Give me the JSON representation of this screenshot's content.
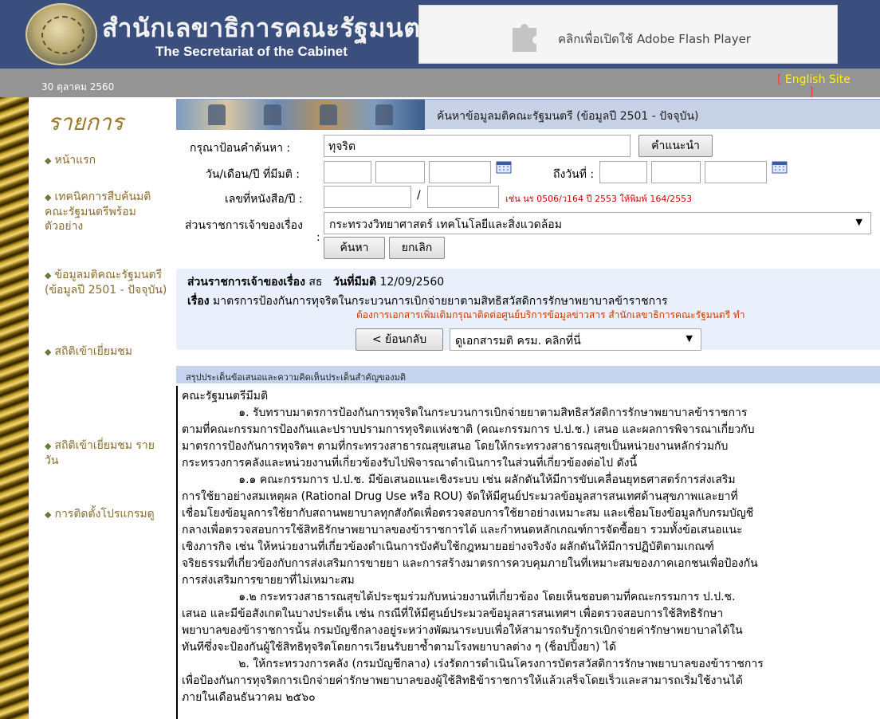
{
  "header": {
    "title_th": "สำนักเลขาธิการคณะรัฐมนตรี",
    "title_en": "The Secretariat of the Cabinet",
    "flash_prompt": "คลิกเพื่อเปิดใช้ Adobe Flash Player"
  },
  "datebar": {
    "date": "30 ตุลาคม 2560",
    "english_site": "English Site",
    "bracket_open": "[",
    "bracket_close": "]"
  },
  "sidebar": {
    "title": "รายการ",
    "items": [
      {
        "label": "หน้าแรก"
      },
      {
        "label": "เทคนิคการสืบค้นมติคณะรัฐมนตรีพร้อมตัวอย่าง"
      },
      {
        "label": "ข้อมูลมติคณะรัฐมนตรี (ข้อมูลปี 2501 - ปัจจุบัน)"
      },
      {
        "label": "สถิติเข้าเยี่ยมชม"
      },
      {
        "label": "สถิติเข้าเยี่ยมชม รายวัน"
      },
      {
        "label": "การติดตั้งโปรแกรมดู"
      }
    ]
  },
  "search": {
    "banner_title": "ค้นหาข้อมูลมติคณะรัฐมนตรี (ข้อมูลปี 2501 - ปัจจุบัน)",
    "keyword_label": "กรุณาป้อนคำค้นหา :",
    "keyword_value": "ทุจริต",
    "suggest_button": "คำแนะนำ",
    "date_label": "วัน/เดือน/ปี ที่มีมติ :",
    "to_date_label": "ถึงวันที่ :",
    "doc_no_label": "เลขที่หนังสือ/ปี :",
    "doc_slash": "/",
    "doc_hint": "เช่น นร 0506/ว164 ปี 2553 ให้พิมพ์ 164/2553",
    "agency_label": "ส่วนราชการเจ้าของเรื่อง",
    "agency_colon": ":",
    "agency_value": "กระทรวงวิทยาศาสตร์ เทคโนโลยีและสิ่งแวดล้อม",
    "search_button": "ค้นหา",
    "cancel_button": "ยกเลิก"
  },
  "result": {
    "agency_caption": "ส่วนราชการเจ้าของเรื่อง",
    "agency_value": "สธ",
    "date_caption": "วันที่มีมติ",
    "date_value": "12/09/2560",
    "subject_caption": "เรื่อง",
    "subject_value": "มาตรการป้องกันการทุจริตในกระบวนการเบิกจ่ายยาตามสิทธิสวัสดิการรักษาพยาบาลข้าราชการ",
    "note": "ต้องการเอกสารเพิ่มเติมกรุณาติดต่อศูนย์บริการข้อมูลข่าวสาร สำนักเลขาธิการคณะรัฐมนตรี ทำ",
    "back_button": "< ย้อนกลับ",
    "docs_select": "ดูเอกสารมติ ครม. คลิกที่นี่"
  },
  "summary": {
    "label": "สรุปประเด็นข้อเสนอและความคิดเห็นประเด็นสำคัญของมติ",
    "lines": [
      "คณะรัฐมนตรีมีมติ",
      "                ๑. รับทราบมาตรการป้องกันการทุจริตในกระบวนการเบิกจ่ายยาตามสิทธิสวัสดิการรักษาพยาบาลข้าราชการ",
      "ตามที่คณะกรรมการป้องกันและปราบปรามการทุจริตแห่งชาติ (คณะกรรมการ ป.ป.ช.) เสนอ และผลการพิจารณาเกี่ยวกับ",
      "มาตรการป้องกันการทุจริตฯ ตามที่กระทรวงสาธารณสุขเสนอ โดยให้กระทรวงสาธารณสุขเป็นหน่วยงานหลักร่วมกับ",
      "กระทรวงการคลังและหน่วยงานที่เกี่ยวข้องรับไปพิจารณาดำเนินการในส่วนที่เกี่ยวข้องต่อไป ดังนี้",
      "                ๑.๑ คณะกรรมการ ป.ป.ช. มีข้อเสนอแนะเชิงระบบ เช่น ผลักดันให้มีการขับเคลื่อนยุทธศาสตร์การส่งเสริม",
      "การใช้ยาอย่างสมเหตุผล (Rational Drug Use หรือ ROU) จัดให้มีศูนย์ประมวลข้อมูลสารสนเทศด้านสุขภาพและยาที่",
      "เชื่อมโยงข้อมูลการใช้ยากับสถานพยาบาลทุกสังกัดเพื่อตรวจสอบการใช้ยาอย่างเหมาะสม และเชื่อมโยงข้อมูลกับกรมบัญชี",
      "กลางเพื่อตรวจสอบการใช้สิทธิรักษาพยาบาลของข้าราชการได้ และกำหนดหลักเกณฑ์การจัดซื้อยา รวมทั้งข้อเสนอแนะ",
      "เชิงภารกิจ เช่น ให้หน่วยงานที่เกี่ยวข้องดำเนินการบังคับใช้กฎหมายอย่างจริงจัง ผลักดันให้มีการปฏิบัติตามเกณฑ์",
      "จริยธรรมที่เกี่ยวข้องกับการส่งเสริมการขายยา และการสร้างมาตรการควบคุมภายในที่เหมาะสมของภาคเอกชนเพื่อป้องกัน",
      "การส่งเสริมการขายยาที่ไม่เหมาะสม",
      "                ๑.๒ กระทรวงสาธารณสุขได้ประชุมร่วมกับหน่วยงานที่เกี่ยวข้อง โดยเห็นชอบตามที่คณะกรรมการ ป.ป.ช.",
      "เสนอ และมีข้อสังเกตในบางประเด็น เช่น กรณีที่ให้มีศูนย์ประมวลข้อมูลสารสนเทศฯ เพื่อตรวจสอบการใช้สิทธิรักษา",
      "พยาบาลของข้าราชการนั้น กรมบัญชีกลางอยู่ระหว่างพัฒนาระบบเพื่อให้สามารถรับรู้การเบิกจ่ายค่ารักษาพยาบาลได้ใน",
      "ทันทีซึ่งจะป้องกันผู้ใช้สิทธิทุจริตโดยการเวียนรับยาซ้ำตามโรงพยาบาลต่าง ๆ (ช็อปปิ้งยา) ได้",
      "                ๒. ให้กระทรวงการคลัง (กรมบัญชีกลาง) เร่งรัดการดำเนินโครงการบัตรสวัสดิการรักษาพยาบาลของข้าราชการ",
      "เพื่อป้องกันการทุจริตการเบิกจ่ายค่ารักษาพยาบาลของผู้ใช้สิทธิข้าราชการให้แล้วเสร็จโดยเร็วและสามารถเริ่มใช้งานได้",
      "ภายในเดือนธันวาคม ๒๕๖๐"
    ]
  },
  "colors": {
    "header_bg": "#3a4f7e",
    "menu_text": "#8a6c2b",
    "hint_red": "#d00000",
    "english_site": "#fff200"
  },
  "icons": [
    "puzzle-plugin-icon",
    "calendar-icon",
    "dropdown-arrow-icon",
    "diamond-bullet-icon",
    "cabinet-seal-logo"
  ]
}
